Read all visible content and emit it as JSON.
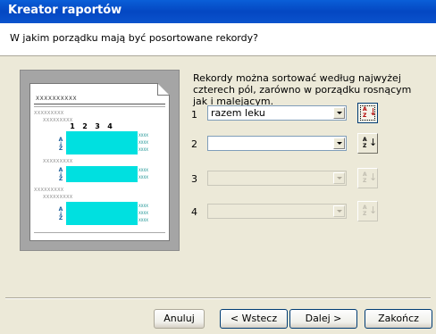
{
  "window": {
    "title": "Kreator raportów",
    "question": "W jakim porządku mają być posortowane rekordy?"
  },
  "preview": {
    "header_text": "XXXXXXXXXX",
    "column_numbers": [
      "1",
      "2",
      "3",
      "4"
    ],
    "group_text": "XXXXXXXXX",
    "subgroup_text": "XXXXXXXXX",
    "cell_text": "XXXX",
    "sort_letters": [
      "A",
      "Z"
    ]
  },
  "description": "Rekordy można sortować według najwyżej czterech pól, zarówno w porządku rosnącym jak i malejącym.",
  "sort_fields": [
    {
      "number": "1",
      "value": "razem leku",
      "enabled": true,
      "icon": "sort-ascending-icon"
    },
    {
      "number": "2",
      "value": "",
      "enabled": true,
      "icon": "sort-ascending-icon"
    },
    {
      "number": "3",
      "value": "",
      "enabled": false,
      "icon": "sort-ascending-icon"
    },
    {
      "number": "4",
      "value": "",
      "enabled": false,
      "icon": "sort-ascending-icon"
    }
  ],
  "buttons": {
    "cancel": "Anuluj",
    "back": "< Wstecz",
    "next": "Dalej >",
    "finish": "Zakończ"
  },
  "colors": {
    "titlebar": "#0a53cd",
    "preview_highlight": "#00e0e0",
    "dialog_bg": "#ece9d8"
  }
}
